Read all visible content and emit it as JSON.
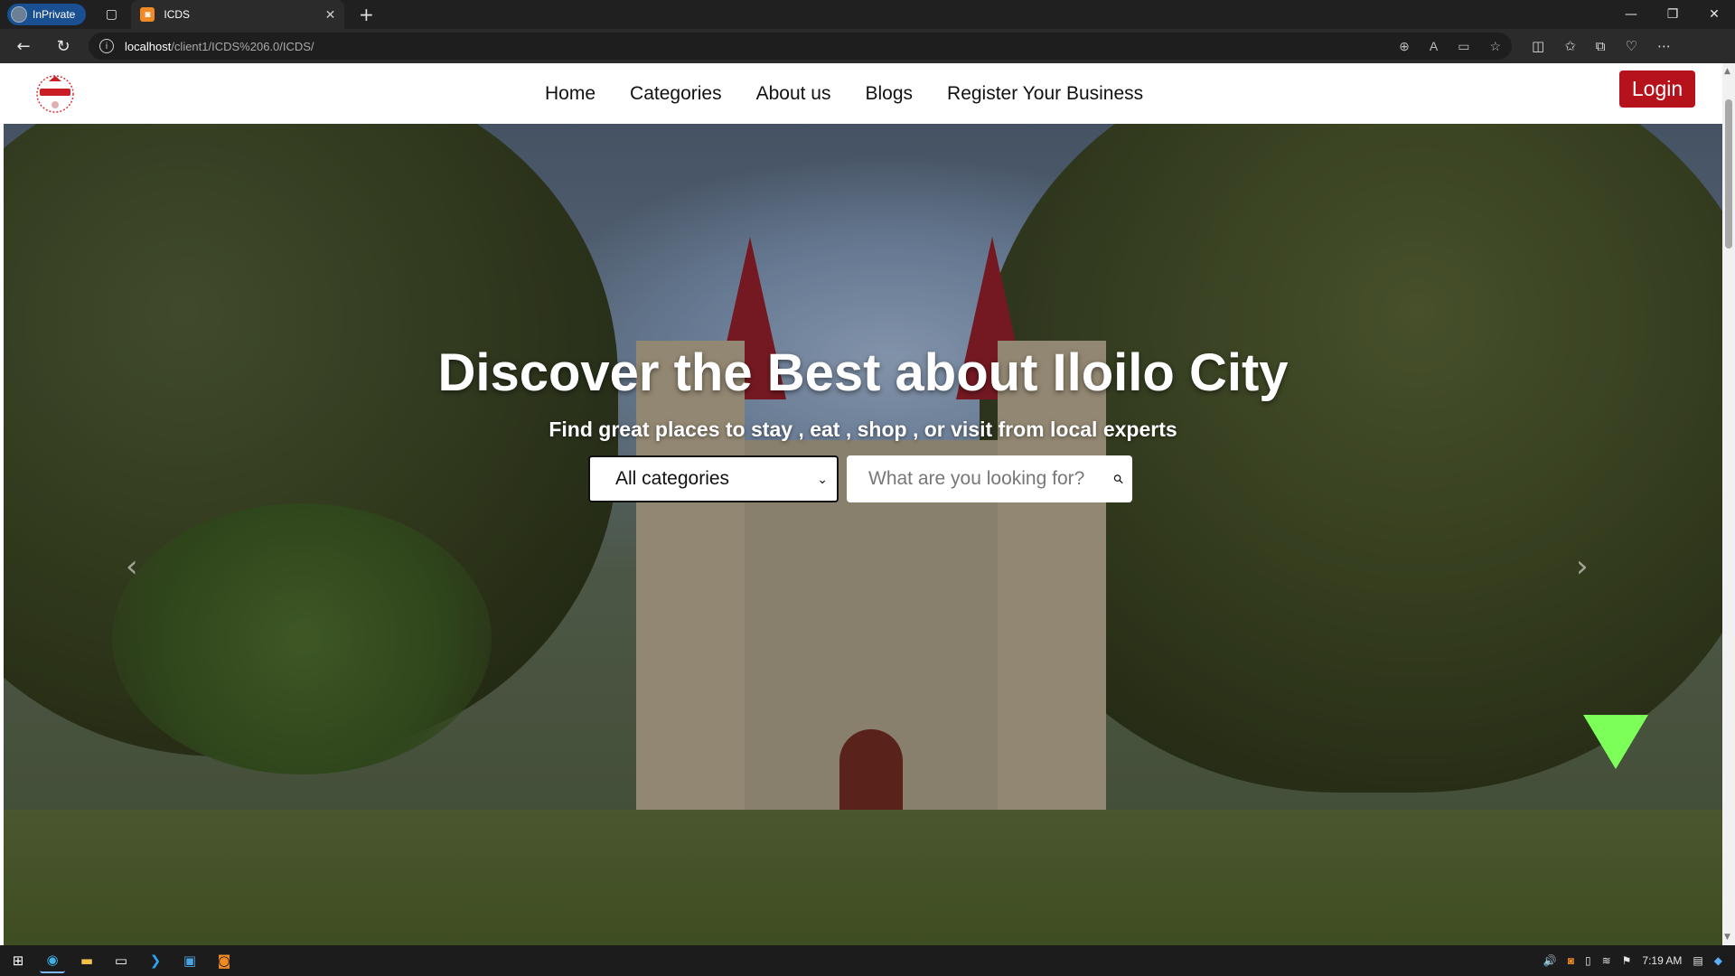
{
  "browser": {
    "profile_label": "InPrivate",
    "tab_title": "ICDS",
    "url_host": "localhost",
    "url_path": "/client1/ICDS%206.0/ICDS/"
  },
  "site": {
    "nav": {
      "items": [
        {
          "label": "Home"
        },
        {
          "label": "Categories"
        },
        {
          "label": "About us"
        },
        {
          "label": "Blogs"
        },
        {
          "label": "Register Your Business"
        }
      ],
      "login_label": "Login"
    },
    "hero": {
      "title": "Discover the Best about Iloilo City",
      "subtitle": "Find great places to stay , eat , shop , or visit from local experts",
      "category_select_value": "All categories",
      "search_placeholder": "What are you looking for?"
    }
  },
  "taskbar": {
    "clock": "7:19 AM"
  },
  "colors": {
    "login_bg": "#b5121b",
    "scroll_hint": "#7dff5a",
    "inprivate_badge": "#1a4f91"
  }
}
